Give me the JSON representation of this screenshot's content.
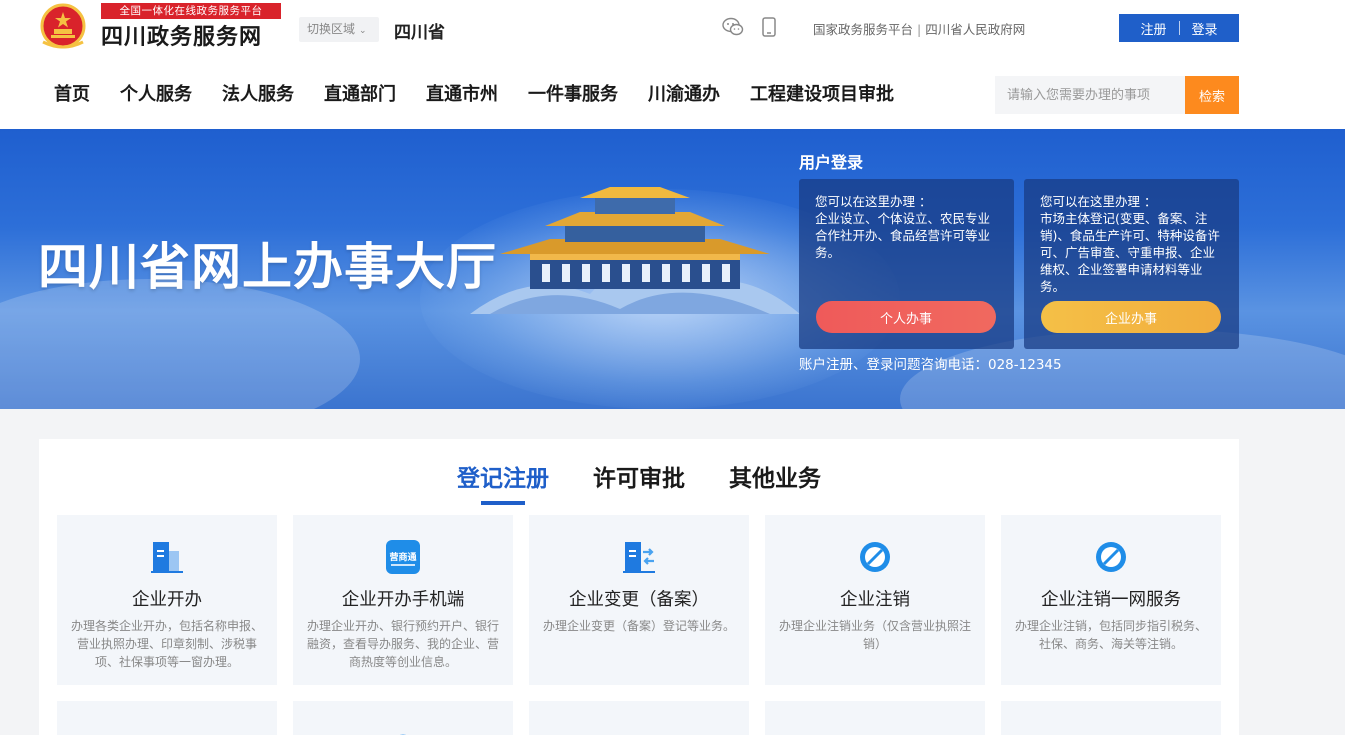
{
  "header": {
    "banner_tag": "全国一体化在线政务服务平台",
    "site_name": "四川政务服务网",
    "region_switch": "切换区域",
    "region_name": "四川省",
    "links": [
      "国家政务服务平台",
      "四川省人民政府网"
    ],
    "register": "注册",
    "login": "登录"
  },
  "nav": [
    "首页",
    "个人服务",
    "法人服务",
    "直通部门",
    "直通市州",
    "一件事服务",
    "川渝通办",
    "工程建设项目审批"
  ],
  "search": {
    "placeholder": "请输入您需要办理的事项",
    "button": "检索"
  },
  "banner": {
    "title": "四川省网上办事大厅",
    "login_title": "用户登录",
    "personal": {
      "heading": "您可以在这里办理 ：",
      "desc": "企业设立、个体设立、农民专业合作社开办、食品经营许可等业务。",
      "button": "个人办事"
    },
    "corp": {
      "heading": "您可以在这里办理 ：",
      "desc": "市场主体登记(变更、备案、注销)、食品生产许可、特种设备许可、广告审查、守重申报、企业维权、企业签署申请材料等业务。",
      "button": "企业办事"
    },
    "hotline": "账户注册、登录问题咨询电话：028-12345"
  },
  "tabs": [
    "登记注册",
    "许可审批",
    "其他业务"
  ],
  "services": [
    {
      "name": "企业开办",
      "desc": "办理各类企业开办，包括名称申报、营业执照办理、印章刻制、涉税事项、社保事项等一窗办理。",
      "icon": "building-icon"
    },
    {
      "name": "企业开办手机端",
      "desc": "办理企业开办、银行预约开户、银行融资，查看导办服务、我的企业、营商热度等创业信息。",
      "icon": "mobile-app-icon",
      "icon_label": "营商通"
    },
    {
      "name": "企业变更（备案）",
      "desc": "办理企业变更（备案）登记等业务。",
      "icon": "building-change-icon"
    },
    {
      "name": "企业注销",
      "desc": "办理企业注销业务（仅含营业执照注销）",
      "icon": "cancel-icon"
    },
    {
      "name": "企业注销一网服务",
      "desc": "办理企业注销，包括同步指引税务、社保、商务、海关等注销。",
      "icon": "cancel-icon"
    }
  ],
  "colors": {
    "primary": "#1f5fc9",
    "accent": "#fd8a1e",
    "red": "#d9232b"
  }
}
